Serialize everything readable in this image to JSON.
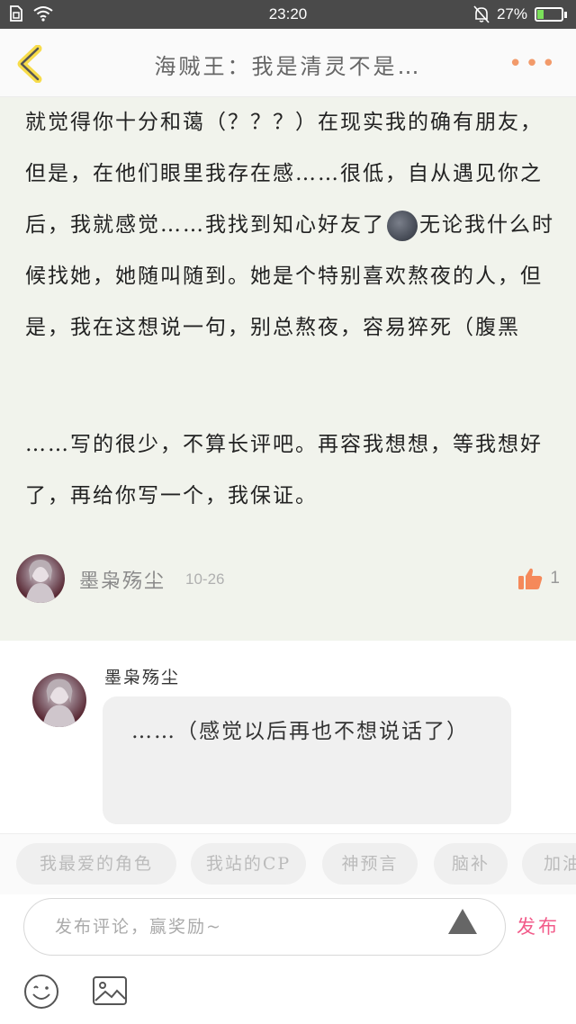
{
  "status_bar": {
    "time": "23:20",
    "battery_percent": "27%",
    "battery_level": 0.27,
    "battery_color": "#7be05a"
  },
  "header": {
    "back_icon": "chevron-left-icon",
    "title": "海贼王：我是清灵不是…",
    "more_icon": "more-dots-icon",
    "accent_color": "#f29a6a"
  },
  "article": {
    "paragraph1_a": "就觉得你十分和蔼（？？？）在现实我的确有朋友，但是，在他们眼里我存在感……很低，自从遇见你之后，我就感觉……我找到知心好友了",
    "paragraph1_b": "无论我什么时候找她，她随叫随到。她是个特别喜欢熬夜的人，但是，我在这想说一句，别总熬夜，容易猝死（腹黑",
    "paragraph2": "……写的很少，不算长评吧。再容我想想，等我想好了，再给你写一个，我保证。",
    "author_name": "墨枭殇尘",
    "date": "10-26",
    "like_count": "1",
    "like_color": "#f5895a"
  },
  "reply": {
    "author_name": "墨枭殇尘",
    "text": "……（感觉以后再也不想说话了）"
  },
  "tags": [
    "我最爱的角色",
    "我站的CP",
    "神预言",
    "脑补",
    "加油"
  ],
  "input": {
    "placeholder": "发布评论，赢奖励~",
    "value": "",
    "publish_label": "发布",
    "publish_color": "#f25b8a"
  }
}
